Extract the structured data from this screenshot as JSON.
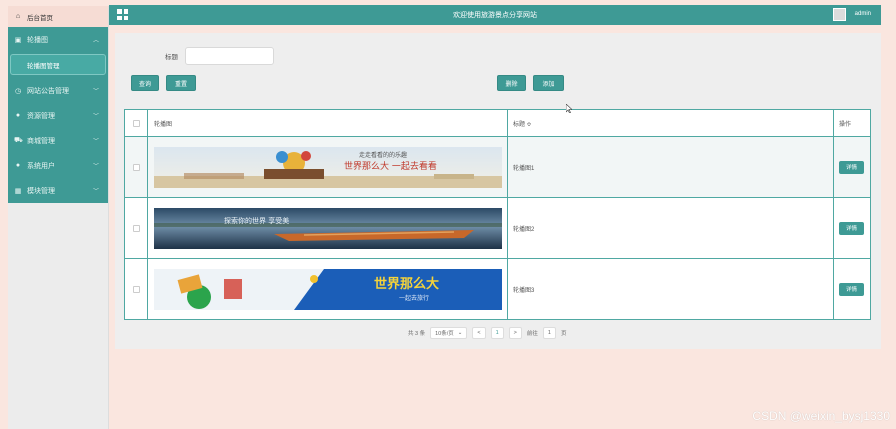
{
  "sidebar": {
    "home": "后台首页",
    "items": [
      {
        "label": "轮播图",
        "icon": "image-icon",
        "expanded": true
      },
      {
        "label": "网站公告管理",
        "icon": "clock-icon"
      },
      {
        "label": "资源管理",
        "icon": "pin-icon"
      },
      {
        "label": "商城管理",
        "icon": "cart-icon"
      },
      {
        "label": "系统用户",
        "icon": "user-icon"
      },
      {
        "label": "模块管理",
        "icon": "grid-icon"
      }
    ],
    "sub_item": "轮播图管理"
  },
  "topbar": {
    "title": "欢迎使用旅游景点分享网站",
    "user": "admin"
  },
  "search": {
    "label": "标题",
    "placeholder": ""
  },
  "buttons": {
    "query": "查询",
    "reset": "重置",
    "delete": "删除",
    "add": "添加"
  },
  "table": {
    "headers": {
      "image": "轮播图",
      "title": "标题 ≎",
      "op": "操作"
    },
    "rows": [
      {
        "title": "轮播图1",
        "action": "详情",
        "banner_text": "世界那么大 一起去看看",
        "banner_caption": "走走看看的的乐趣"
      },
      {
        "title": "轮播图2",
        "action": "详情",
        "banner_text": "探索你的世界 享受美",
        "banner_caption": ""
      },
      {
        "title": "轮播图3",
        "action": "详情",
        "banner_text": "世界那么大",
        "banner_caption": "一起去旅行"
      }
    ]
  },
  "pager": {
    "total": "共 3 条",
    "page_size": "10条/页",
    "prev": "<",
    "current": "1",
    "next": ">",
    "goto_label": "前往",
    "goto_value": "1",
    "page_suffix": "页"
  },
  "watermark": "CSDN @weixin_bysj1330",
  "colors": {
    "accent": "#3e9a95",
    "page_bg": "#fae6df",
    "sidebar_bg": "#ececec"
  }
}
